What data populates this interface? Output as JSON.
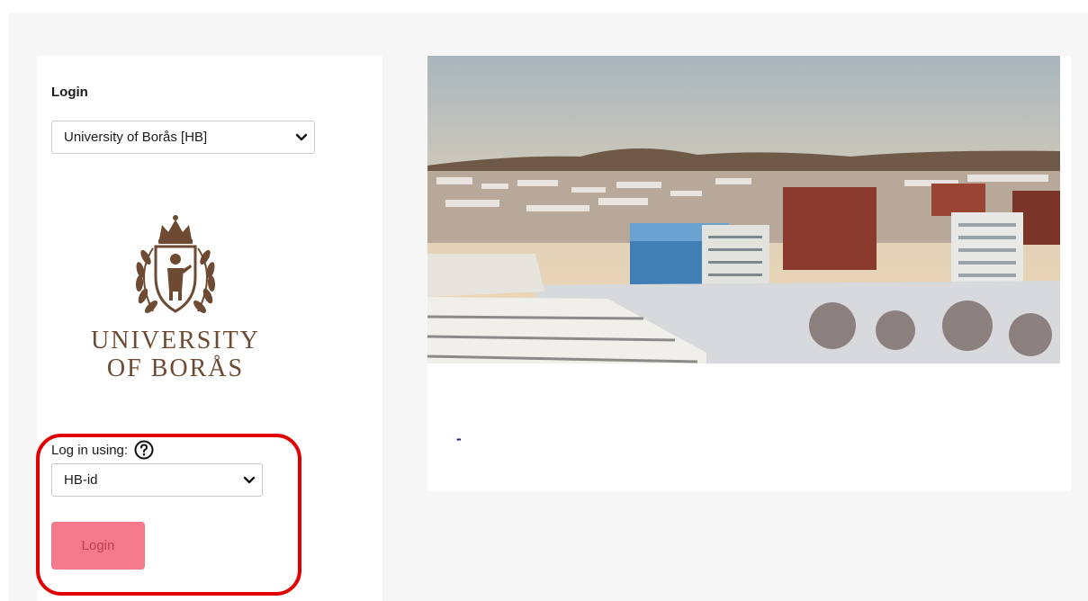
{
  "login_panel": {
    "heading": "Login",
    "organization_select": {
      "selected": "University of Borås [HB]"
    },
    "logo": {
      "emblem_icon": "university-crest-icon",
      "line1": "UNIVERSITY",
      "line2": "OF BORÅS"
    },
    "login_method": {
      "label": "Log in using:",
      "help_icon": "question-circle-icon",
      "selected": "HB-id"
    },
    "login_button_label": "Login"
  },
  "content_panel": {
    "image": "campus-winter-photo",
    "dash_text": "-"
  },
  "colors": {
    "login_button": "#f47989",
    "login_button_text": "#b8404f",
    "highlight": "#e00000",
    "logo": "#6e4a33",
    "page_background": "#f6f6f6"
  }
}
